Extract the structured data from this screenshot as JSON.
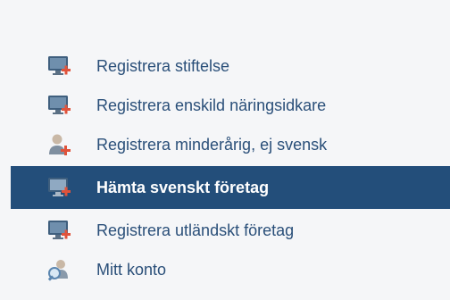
{
  "menu": {
    "items": [
      {
        "label": "Registrera stiftelse",
        "icon": "monitor-add-icon",
        "active": false
      },
      {
        "label": "Registrera enskild näringsidkare",
        "icon": "monitor-add-icon",
        "active": false
      },
      {
        "label": "Registrera minderårig, ej svensk",
        "icon": "person-add-icon",
        "active": false
      },
      {
        "label": "Hämta svenskt företag",
        "icon": "monitor-add-icon",
        "active": true
      },
      {
        "label": "Registrera utländskt företag",
        "icon": "monitor-add-icon",
        "active": false
      },
      {
        "label": "Mitt konto",
        "icon": "user-search-icon",
        "active": false
      }
    ]
  },
  "colors": {
    "link": "#2a4f79",
    "active_bg": "#234e7a",
    "panel_bg": "#f5f6f8",
    "plus": "#e0533b"
  }
}
